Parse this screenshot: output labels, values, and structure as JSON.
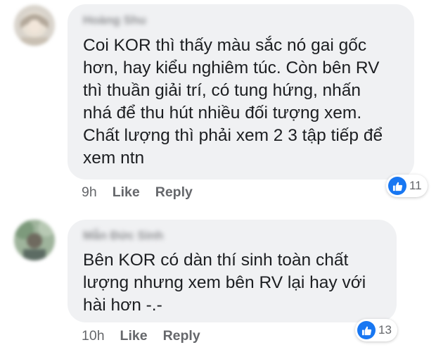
{
  "comments": [
    {
      "author": "Hoàng Shu",
      "text_lines": [
        "Coi KOR thì thấy màu sắc nó gai gốc",
        "hơn, hay kiểu nghiêm túc. Còn bên RV",
        "thì thuần giải trí, có tung hứng, nhấn",
        "nhá để thu hút nhiều đối tượng xem.",
        "Chất lượng thì phải xem 2 3 tập tiếp để",
        "xem ntn"
      ],
      "time": "9h",
      "like_label": "Like",
      "reply_label": "Reply",
      "reaction_icon": "thumbs-up-icon",
      "reaction_count": "11"
    },
    {
      "author": "Mẫn Đức Sinh",
      "text_lines": [
        "Bên KOR có dàn thí sinh toàn chất",
        "lượng nhưng xem bên RV lại hay với",
        "hài hơn -.-"
      ],
      "time": "10h",
      "like_label": "Like",
      "reply_label": "Reply",
      "reaction_icon": "thumbs-up-icon",
      "reaction_count": "13"
    }
  ],
  "colors": {
    "bubble": "#f0f1f3",
    "text": "#1c1e21",
    "meta": "#65676b",
    "like_blue": "#1877f2"
  }
}
